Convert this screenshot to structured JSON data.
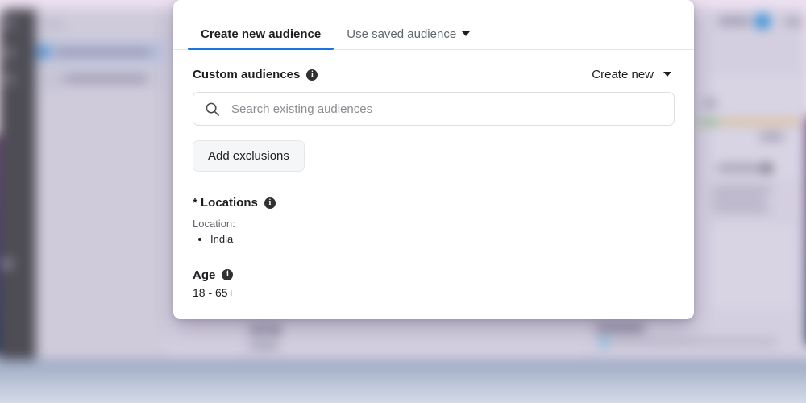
{
  "modal": {
    "tabs": [
      {
        "label": "Create new audience",
        "active": true,
        "has_caret": false
      },
      {
        "label": "Use saved audience",
        "active": false,
        "has_caret": true
      }
    ],
    "custom_audiences": {
      "title": "Custom audiences",
      "info_glyph": "i",
      "create_new_label": "Create new",
      "search_placeholder": "Search existing audiences",
      "search_value": "",
      "search_icon": "search-icon",
      "add_exclusions_label": "Add exclusions"
    },
    "locations": {
      "title": "* Locations",
      "info_glyph": "i",
      "sublabel": "Location:",
      "items": [
        "India"
      ]
    },
    "age": {
      "title": "Age",
      "info_glyph": "i",
      "value": "18 - 65+"
    }
  },
  "colors": {
    "accent_blue": "#1b74e4",
    "text_primary": "#1c1e21",
    "text_secondary": "#606770",
    "placeholder": "#8a8d91",
    "panel_bg": "#ffffff",
    "page_bg": "#ece0f0"
  }
}
